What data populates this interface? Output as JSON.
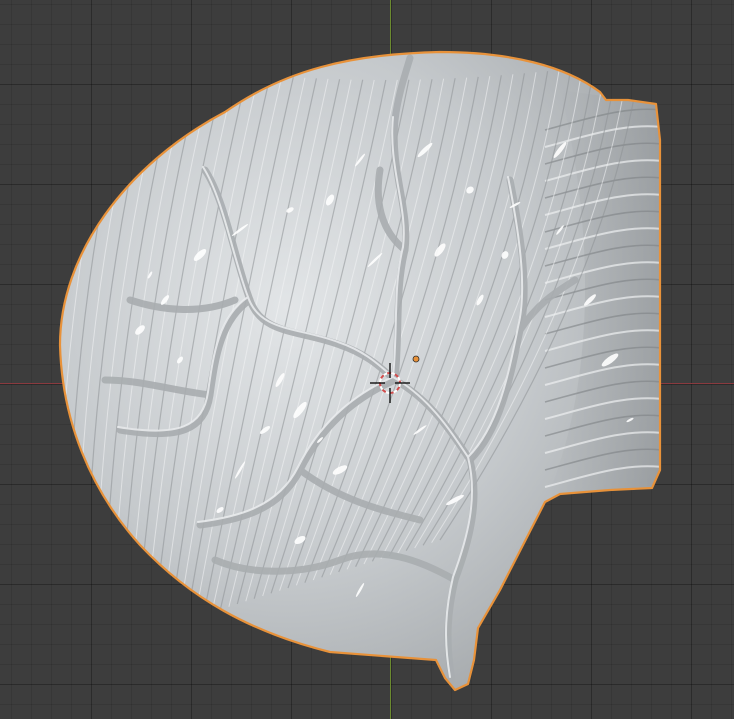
{
  "viewport": {
    "background_color": "#3d3d3d",
    "grid_color": "#333333"
  },
  "axes": {
    "x_axis_color": "#8a3a3f",
    "y_axis_color": "#6b8a2f"
  },
  "object": {
    "kind": "sculpted-mesh",
    "selected": true,
    "surface_color": "#c9cdd0",
    "outline_color": "#e8923a",
    "origin_color": "#e8923a"
  },
  "cursor_3d": {
    "ring_color_a": "#d24b4b",
    "ring_color_b": "#ffffff",
    "crosshair_color": "#111111"
  }
}
